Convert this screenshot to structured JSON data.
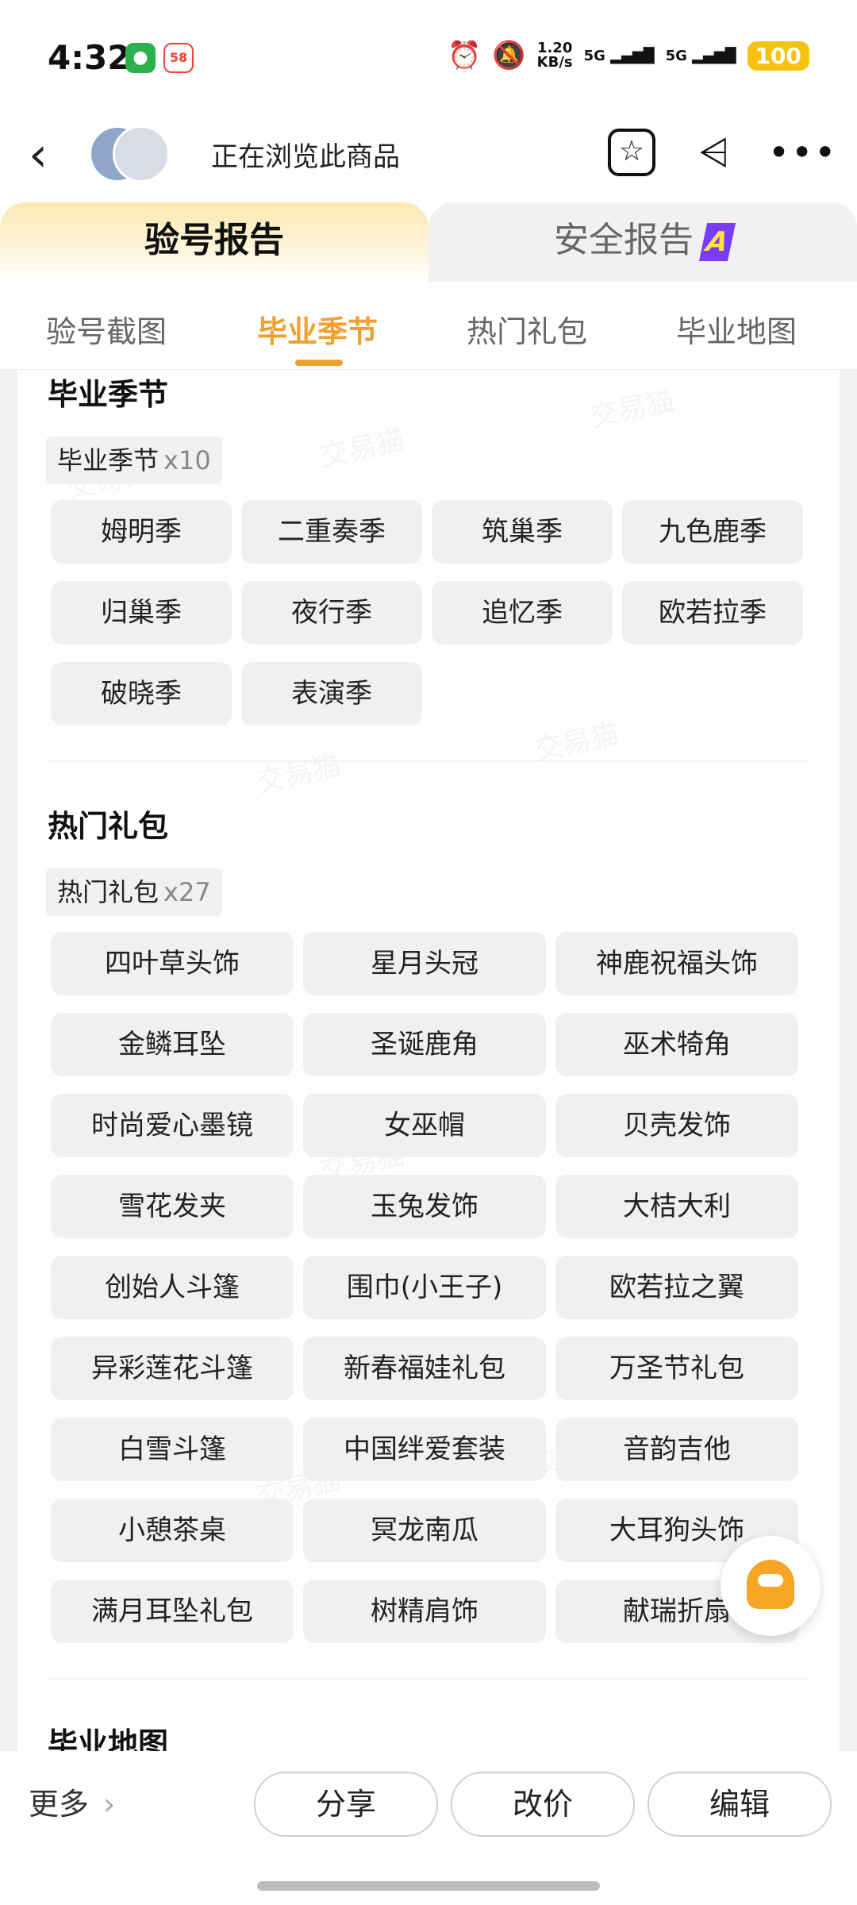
{
  "status_bar": {
    "time": "4:32",
    "wechat_icon": "wechat-icon",
    "app58_label": "58",
    "speed_top": "1.20",
    "speed_bottom": "KB/s",
    "sig1": "5G",
    "sig2": "5G",
    "battery": "100"
  },
  "titlebar": {
    "title": "正在浏览此商品"
  },
  "report_tabs": {
    "active": "验号报告",
    "other": "安全报告",
    "badge": "A"
  },
  "subtabs": [
    "验号截图",
    "毕业季节",
    "热门礼包",
    "毕业地图"
  ],
  "section1": {
    "title": "毕业季节",
    "pill_label": "毕业季节",
    "pill_count": "x10",
    "items": [
      "姆明季",
      "二重奏季",
      "筑巢季",
      "九色鹿季",
      "归巢季",
      "夜行季",
      "追忆季",
      "欧若拉季",
      "破晓季",
      "表演季"
    ]
  },
  "section2": {
    "title": "热门礼包",
    "pill_label": "热门礼包",
    "pill_count": "x27",
    "items": [
      "四叶草头饰",
      "星月头冠",
      "神鹿祝福头饰",
      "金鳞耳坠",
      "圣诞鹿角",
      "巫术犄角",
      "时尚爱心墨镜",
      "女巫帽",
      "贝壳发饰",
      "雪花发夹",
      "玉兔发饰",
      "大桔大利",
      "创始人斗篷",
      "围巾(小王子)",
      "欧若拉之翼",
      "异彩莲花斗篷",
      "新春福娃礼包",
      "万圣节礼包",
      "白雪斗篷",
      "中国绊爱套装",
      "音韵吉他",
      "小憩茶桌",
      "冥龙南瓜",
      "大耳狗头饰",
      "满月耳坠礼包",
      "树精肩饰",
      "献瑞折扇"
    ]
  },
  "section3": {
    "title": "毕业地图"
  },
  "watermark": "交易猫",
  "bottom": {
    "more": "更多",
    "share": "分享",
    "reprice": "改价",
    "edit": "编辑"
  }
}
